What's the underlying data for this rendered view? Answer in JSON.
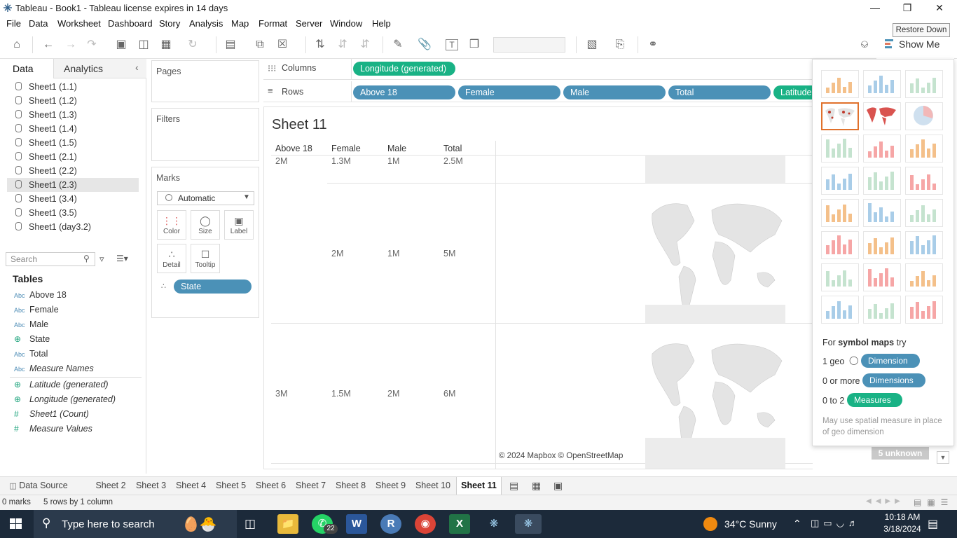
{
  "window": {
    "title": "Tableau - Book1 - Tableau license expires in 14 days",
    "tooltip": "Restore Down"
  },
  "menu": [
    "File",
    "Data",
    "Worksheet",
    "Dashboard",
    "Story",
    "Analysis",
    "Map",
    "Format",
    "Server",
    "Window",
    "Help"
  ],
  "toolbar": {
    "show_me_label": "Show Me"
  },
  "data_pane": {
    "tabs": [
      "Data",
      "Analytics"
    ],
    "sources": [
      "Sheet1 (1.1)",
      "Sheet1 (1.2)",
      "Sheet1 (1.3)",
      "Sheet1 (1.4)",
      "Sheet1 (1.5)",
      "Sheet1 (2.1)",
      "Sheet1 (2.2)",
      "Sheet1 (2.3)",
      "Sheet1 (3.4)",
      "Sheet1 (3.5)",
      "Sheet1 (day3.2)"
    ],
    "selected_source": "Sheet1 (2.3)",
    "search_placeholder": "Search",
    "tables_heading": "Tables",
    "fields": [
      {
        "type": "Abc",
        "name": "Above 18",
        "italic": false
      },
      {
        "type": "Abc",
        "name": "Female",
        "italic": false
      },
      {
        "type": "Abc",
        "name": "Male",
        "italic": false
      },
      {
        "type": "geo",
        "name": "State",
        "italic": false
      },
      {
        "type": "Abc",
        "name": "Total",
        "italic": false
      },
      {
        "type": "Abc",
        "name": "Measure Names",
        "italic": true
      }
    ],
    "measures": [
      {
        "type": "geo",
        "name": "Latitude (generated)"
      },
      {
        "type": "geo",
        "name": "Longitude (generated)"
      },
      {
        "type": "#",
        "name": "Sheet1 (Count)"
      },
      {
        "type": "#",
        "name": "Measure Values"
      }
    ]
  },
  "shelves": {
    "pages_label": "Pages",
    "filters_label": "Filters",
    "marks_label": "Marks",
    "mark_type": "Automatic",
    "mark_buttons": [
      "Color",
      "Size",
      "Label",
      "Detail",
      "Tooltip"
    ],
    "detail_pill": "State",
    "columns_label": "Columns",
    "rows_label": "Rows",
    "columns_pills": [
      "Longitude (generated)"
    ],
    "rows_pills": [
      "Above 18",
      "Female",
      "Male",
      "Total",
      "Latitude"
    ]
  },
  "view": {
    "sheet_title": "Sheet 11",
    "headers": [
      "Above 18",
      "Female",
      "Male",
      "Total"
    ],
    "rows": [
      [
        "2M",
        "1.3M",
        "1M",
        "2.5M"
      ],
      [
        "",
        "2M",
        "1M",
        "5M"
      ],
      [
        "3M",
        "1.5M",
        "2M",
        "6M"
      ]
    ],
    "attribution": "© 2024 Mapbox © OpenStreetMap",
    "unknown_badge": "5 unknown"
  },
  "show_me": {
    "hint_prefix": "For",
    "hint_bold": "symbol maps",
    "hint_suffix": "try",
    "req1_prefix": "1 geo",
    "req1_pill": "Dimension",
    "req2_prefix": "0 or more",
    "req2_pill": "Dimensions",
    "req3_prefix": "0 to 2",
    "req3_pill": "Measures",
    "note": "May use spatial measure in place of geo dimension"
  },
  "sheet_tabs": [
    "Data Source",
    "Sheet 2",
    "Sheet 3",
    "Sheet 4",
    "Sheet 5",
    "Sheet 6",
    "Sheet 7",
    "Sheet 8",
    "Sheet 9",
    "Sheet 10",
    "Sheet 11"
  ],
  "active_tab": "Sheet 11",
  "status": {
    "marks": "0 marks",
    "rows_cols": "5 rows by 1 column"
  },
  "taskbar": {
    "search_placeholder": "Type here to search",
    "whatsapp_badge": "22",
    "weather": "34°C  Sunny",
    "time": "10:18 AM",
    "date": "3/18/2024"
  },
  "colors": {
    "dimension_pill": "#4b91b7",
    "measure_pill": "#19b285",
    "selected_thumb": "#e0712c"
  }
}
